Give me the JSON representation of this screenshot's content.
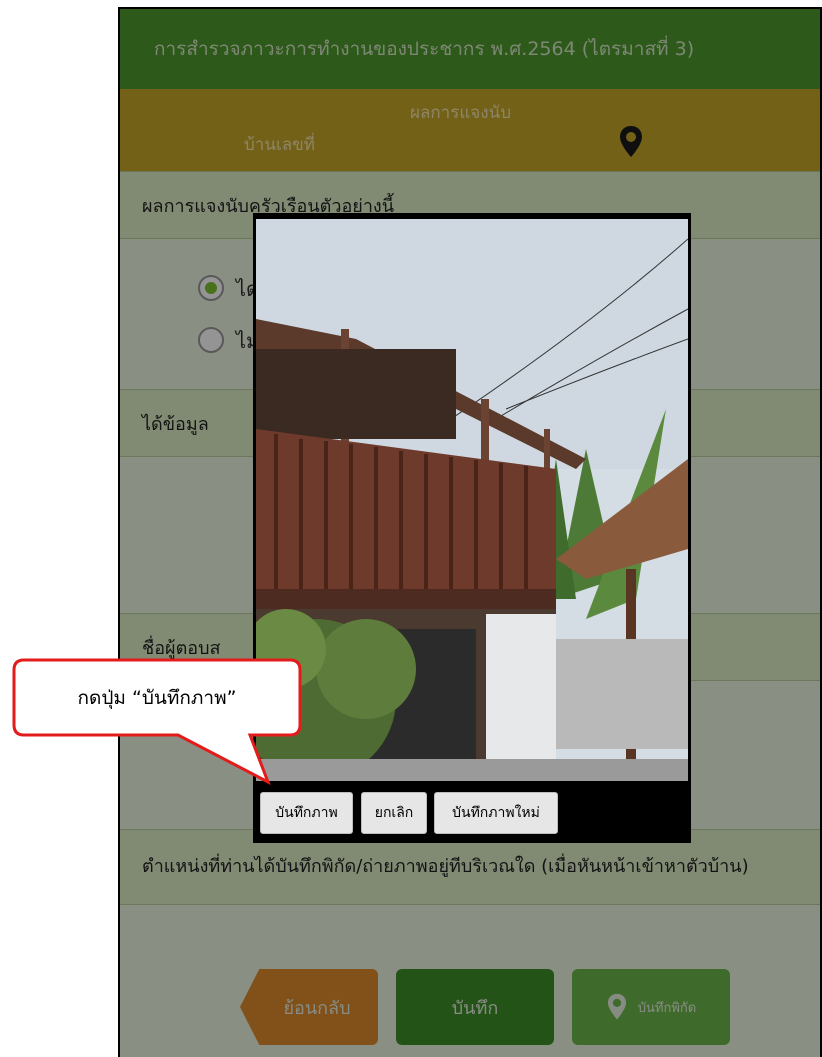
{
  "header": {
    "title": "การสำรวจภาวะการทำงานของประชากร พ.ศ.2564 (ไตรมาสที่ 3)"
  },
  "subheader": {
    "title": "ผลการแจงนับ",
    "house_label": "บ้านเลขที่"
  },
  "sections": {
    "result": "ผลการแจงนับครัวเรือนตัวอย่างนี้",
    "got_data": "ได้ข้อมูล",
    "respondent": "ชื่อผู้ตอบส",
    "position": "ตำแหน่งที่ท่านได้บันทึกพิกัด/ถ่ายภาพอยู่ทีบริเวณใด (เมื่อหันหน้าเข้าหาตัวบ้าน)"
  },
  "radios": [
    {
      "label": "ได",
      "selected": true
    },
    {
      "label": "ไม",
      "selected": false
    }
  ],
  "dialog": {
    "save_photo": "บันทึกภาพ",
    "cancel": "ยกเลิก",
    "retake": "บันทึกภาพใหม่"
  },
  "bottom": {
    "back": "ย้อนกลับ",
    "save": "บันทึก",
    "save_coord": "บันทึกพิกัด"
  },
  "callout": {
    "text": "กดปุ่ม “บันทึกภาพ”"
  },
  "colors": {
    "header": "#4f9a2d",
    "subheader": "#c7a828",
    "section": "#dff0c8",
    "back": "#e08a2c",
    "save": "#3f8f2a",
    "callout_border": "#e31b1b"
  }
}
